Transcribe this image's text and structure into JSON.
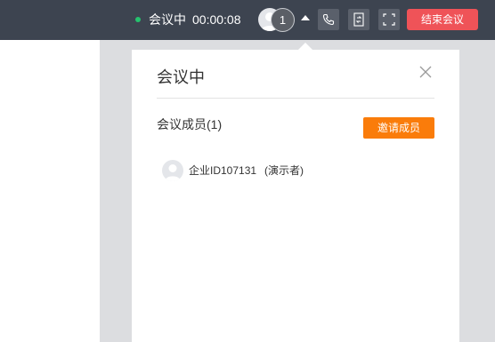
{
  "topbar": {
    "status_text": "会议中",
    "timer": "00:00:08",
    "participant_count": "1",
    "end_meeting_label": "结束会议",
    "status_color": "#25c26e",
    "end_button_color": "#ef5358",
    "icons": [
      "phone-icon",
      "share-screen-icon",
      "fullscreen-icon"
    ]
  },
  "panel": {
    "title": "会议中",
    "members_label": "会议成员(1)",
    "invite_label": "邀请成员",
    "invite_color": "#fa7c0a",
    "members": [
      {
        "name": "企业ID107131",
        "role": "(演示者)"
      }
    ]
  }
}
